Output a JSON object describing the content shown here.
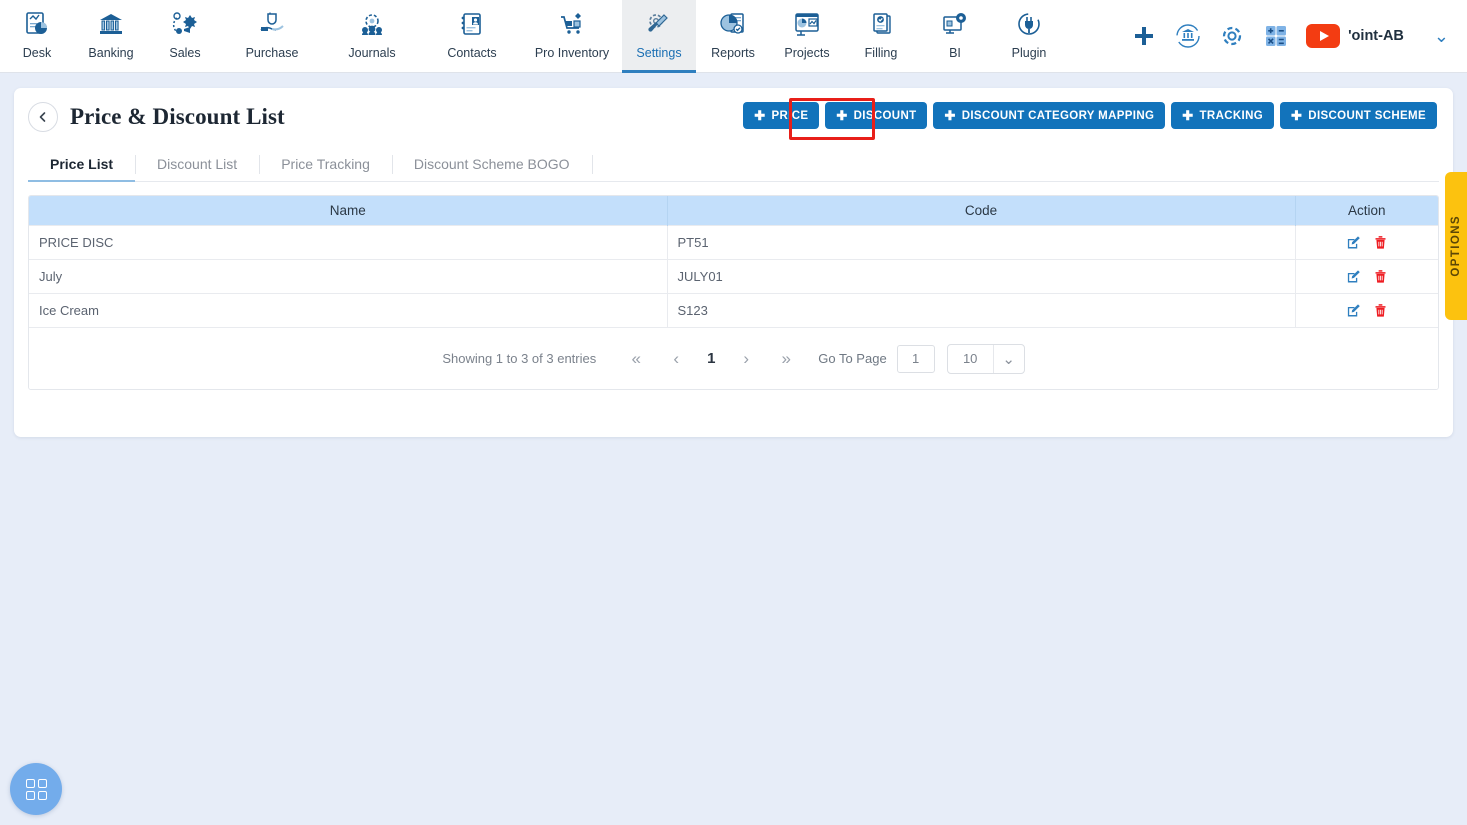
{
  "topnav": {
    "items": [
      {
        "label": "Desk",
        "icon": "desk-chart-icon"
      },
      {
        "label": "Banking",
        "icon": "bank-building-icon"
      },
      {
        "label": "Sales",
        "icon": "sales-megaphone-icon"
      },
      {
        "label": "Purchase",
        "icon": "purchase-hand-icon"
      },
      {
        "label": "Journals",
        "icon": "journals-gear-people-icon"
      },
      {
        "label": "Contacts",
        "icon": "contacts-card-icon"
      },
      {
        "label": "Pro Inventory",
        "icon": "inventory-cart-icon"
      },
      {
        "label": "Settings",
        "icon": "settings-gear-wrench-icon"
      },
      {
        "label": "Reports",
        "icon": "reports-piechart-icon"
      },
      {
        "label": "Projects",
        "icon": "projects-dashboard-icon"
      },
      {
        "label": "Filling",
        "icon": "filling-documents-icon"
      },
      {
        "label": "BI",
        "icon": "bi-monitor-gear-icon"
      },
      {
        "label": "Plugin",
        "icon": "plugin-plug-icon"
      }
    ],
    "active_item": "Settings",
    "right_icons": [
      {
        "name": "add-plus-icon"
      },
      {
        "name": "bank-sync-icon"
      },
      {
        "name": "settings-gear-icon"
      },
      {
        "name": "calculator-icon"
      },
      {
        "name": "youtube-icon"
      }
    ],
    "account_name": "'oint-AB",
    "account_caret": "⌄"
  },
  "header": {
    "back_icon": "chevron-left-icon",
    "title": "Price & Discount List"
  },
  "action_buttons": [
    {
      "label": "PRICE",
      "highlighted": true
    },
    {
      "label": "DISCOUNT",
      "highlighted": false
    },
    {
      "label": "DISCOUNT CATEGORY MAPPING",
      "highlighted": false
    },
    {
      "label": "TRACKING",
      "highlighted": false
    },
    {
      "label": "DISCOUNT SCHEME",
      "highlighted": false
    }
  ],
  "plus_glyph": "✚",
  "tabs": [
    {
      "label": "Price List",
      "active": true
    },
    {
      "label": "Discount List",
      "active": false
    },
    {
      "label": "Price Tracking",
      "active": false
    },
    {
      "label": "Discount Scheme BOGO",
      "active": false
    }
  ],
  "table": {
    "columns": [
      "Name",
      "Code",
      "Action"
    ],
    "rows": [
      {
        "name": "PRICE DISC",
        "code": "PT51"
      },
      {
        "name": "July",
        "code": "JULY01"
      },
      {
        "name": "Ice Cream",
        "code": "S123"
      }
    ],
    "row_action_icons": [
      "edit-pencil-icon",
      "delete-trash-icon"
    ]
  },
  "pagination": {
    "showing_text": "Showing 1 to 3 of 3 entries",
    "first_glyph": "«",
    "prev_glyph": "‹",
    "current_page": "1",
    "next_glyph": "›",
    "last_glyph": "»",
    "goto_label": "Go To Page",
    "goto_value": "1",
    "goto_placeholder": "1",
    "page_size_value": "10",
    "page_size_chev": "⌄"
  },
  "options_tab": {
    "label": "OPTIONS"
  },
  "fab": {
    "icon": "grid-apps-icon"
  },
  "colors": {
    "page_bg": "#e7edf8",
    "button_blue": "#1273bb",
    "table_header_blue": "#c3dffb",
    "highlight_red": "#e81f19",
    "options_yellow": "#fcc20f",
    "fab_blue": "#73aceb",
    "youtube_red": "#f33c12"
  }
}
